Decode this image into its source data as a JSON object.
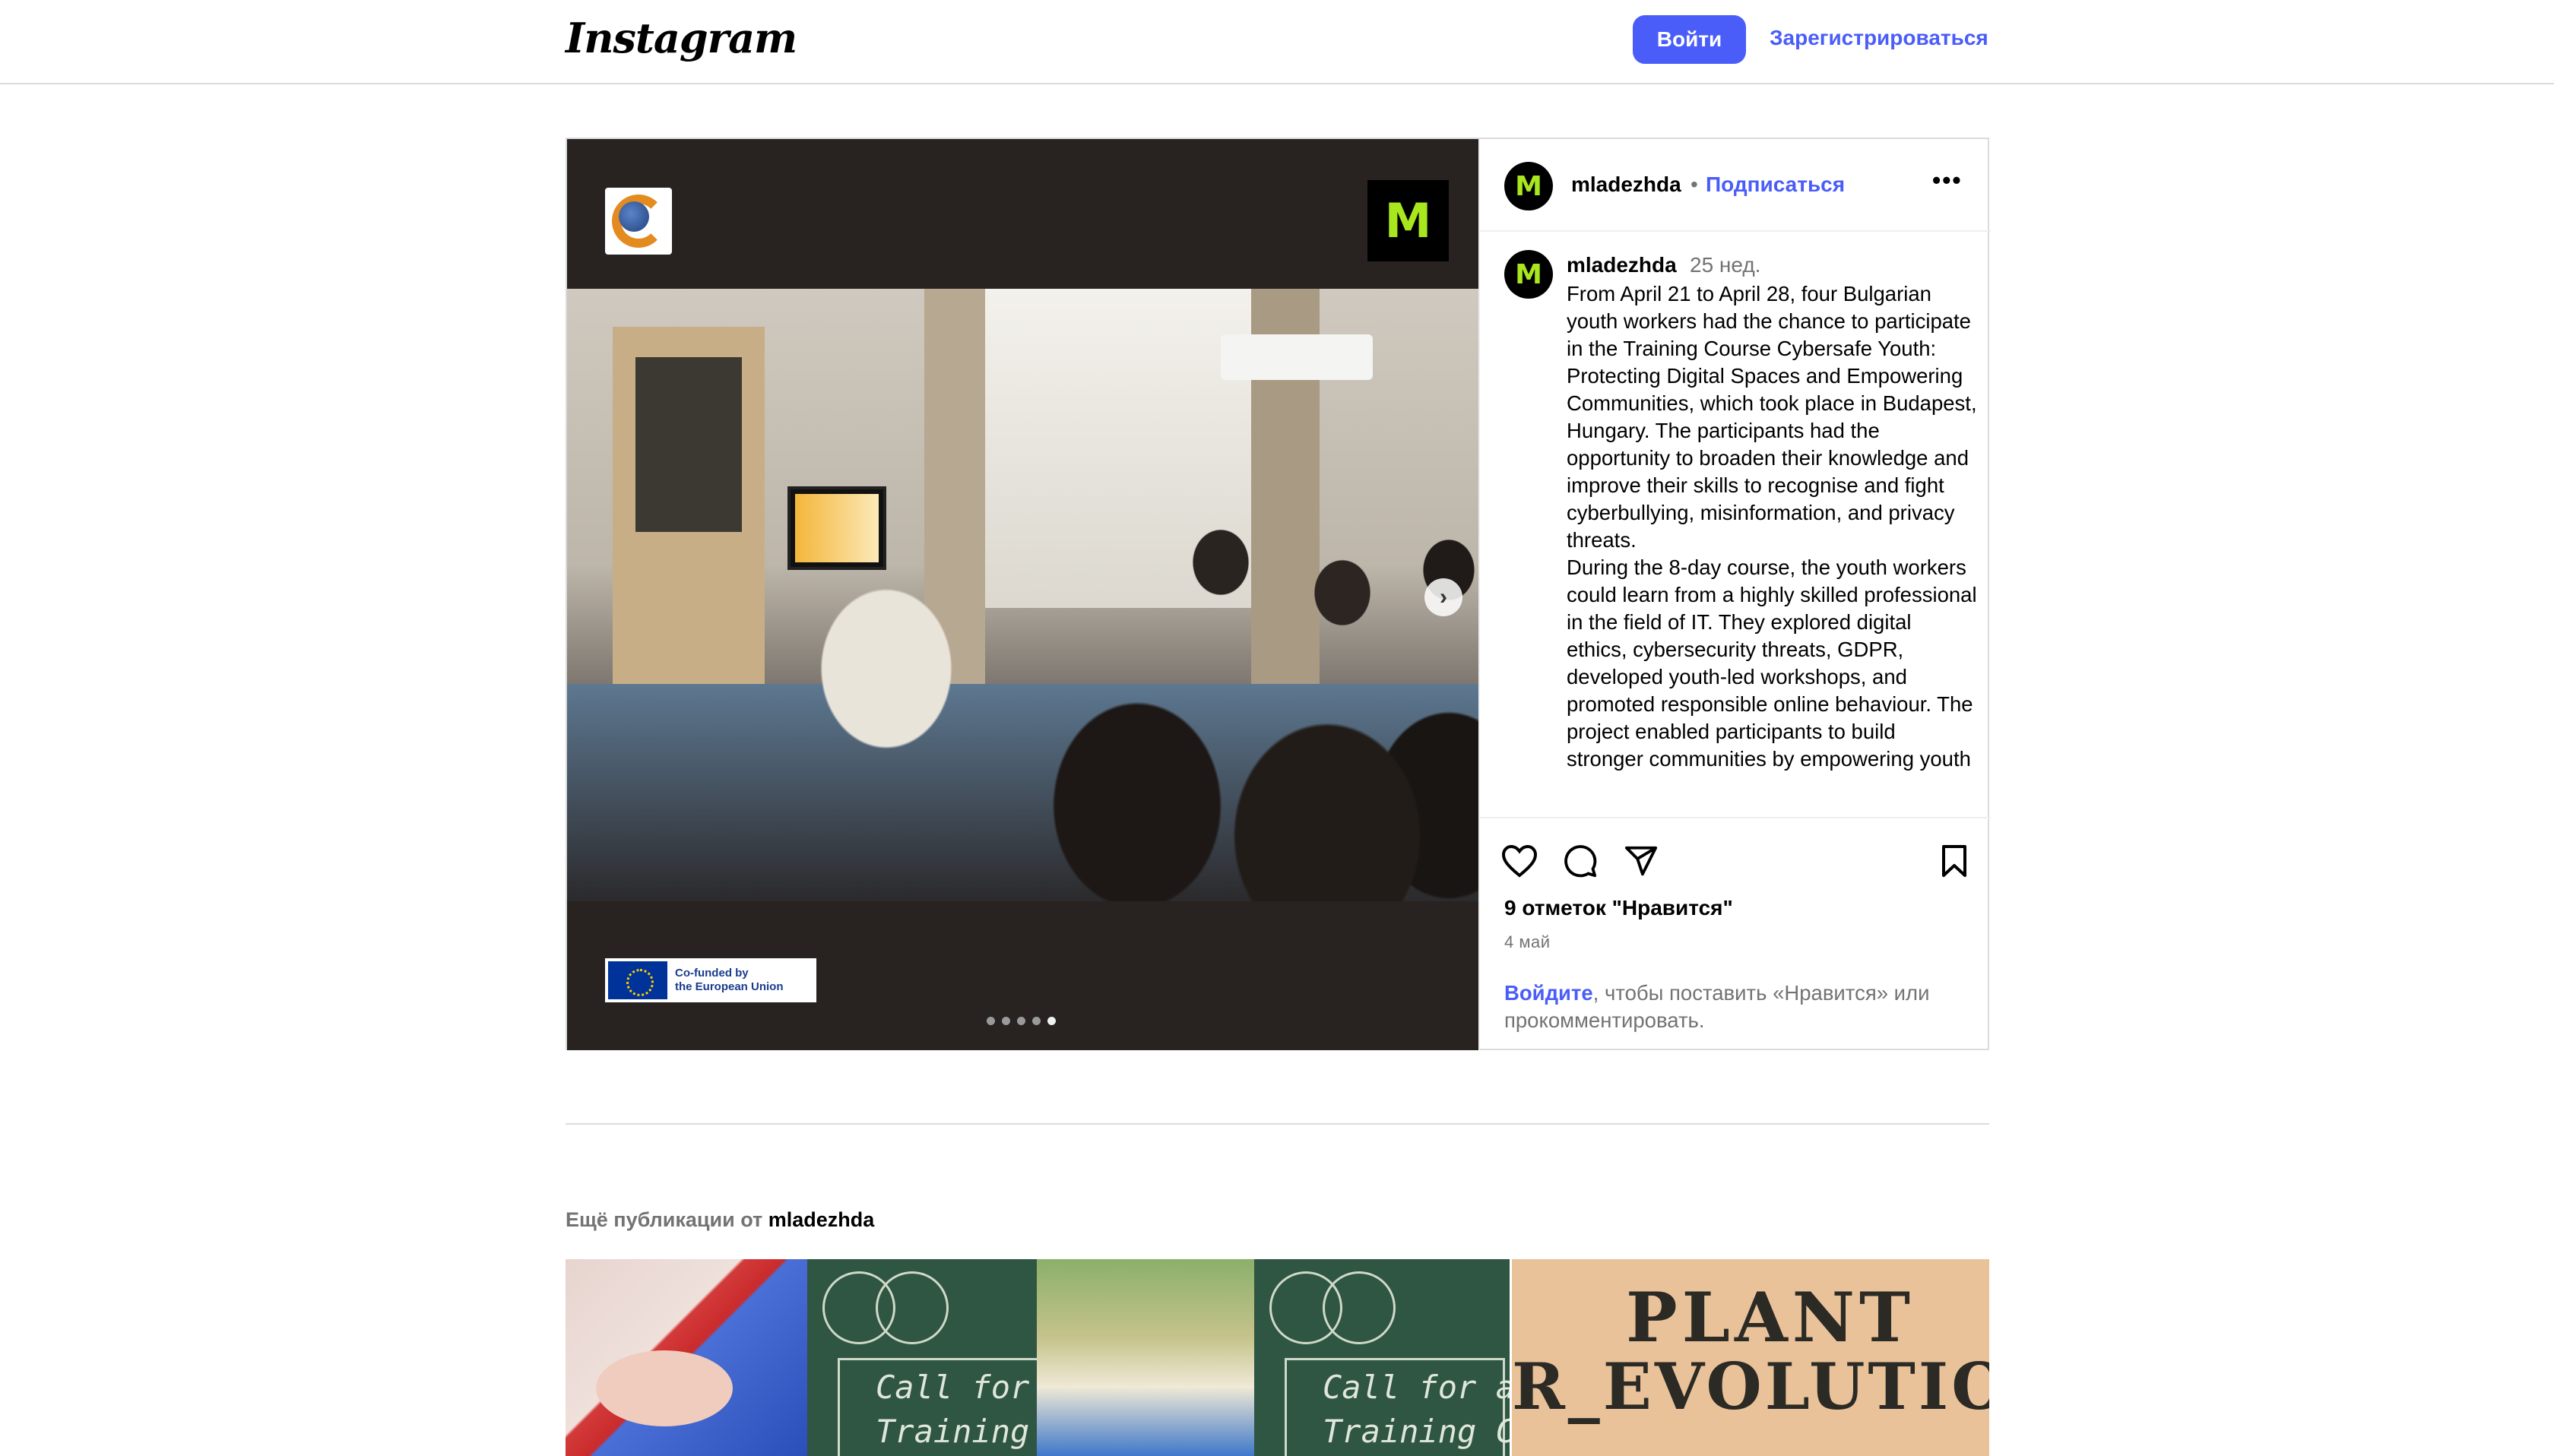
{
  "header": {
    "logo_text": "Instagram",
    "login_label": "Войти",
    "signup_label": "Зарегистрироваться"
  },
  "post": {
    "media": {
      "eu_badge_line1": "Co-funded by",
      "eu_badge_line2": "the European Union",
      "carousel_count": 5,
      "carousel_index": 4
    },
    "author": {
      "username": "mladezhda",
      "avatar_letter": "M",
      "separator": "•",
      "follow_label": "Подписаться"
    },
    "caption": {
      "username": "mladezhda",
      "time": "25 нед.",
      "paragraph1": "From April 21 to April 28, four Bulgarian youth workers had the chance to participate in the Training Course Cybersafe Youth: Protecting Digital Spaces and Empowering Communities, which took place in Budapest, Hungary. The participants had the opportunity to broaden their knowledge and improve their skills to recognise and fight cyberbullying, misinformation, and privacy threats.",
      "paragraph2": "During the 8-day course, the youth workers could learn from a highly skilled professional in the field of IT. They explored digital ethics, cybersecurity threats, GDPR, developed youth-led workshops, and promoted responsible online behaviour. The project enabled participants to build stronger communities by empowering youth"
    },
    "likes": "9 отметок \"Нравится\"",
    "date": "4 май",
    "login_prompt_link": "Войдите",
    "login_prompt_rest": ", чтобы поставить «Нравится» или прокомментировать."
  },
  "more": {
    "title_prefix": "Ещё публикации от ",
    "username": "mladezhda",
    "thumbnails": [
      {
        "label": ""
      },
      {
        "line1": "Call for a",
        "line2": "Training Cou"
      },
      {
        "label": ""
      },
      {
        "line1": "Call for a",
        "line2": "Training Cours"
      },
      {
        "line1": "PLANT",
        "line2": "R_EVOLUTION"
      }
    ]
  },
  "colors": {
    "accent": "#4a5df9",
    "brand_green": "#a8e61d",
    "border": "#dbdbdb",
    "muted_text": "#737373"
  },
  "icons": [
    "more-options-icon",
    "carousel-next-icon",
    "heart-icon",
    "comment-icon",
    "share-icon",
    "bookmark-icon"
  ]
}
